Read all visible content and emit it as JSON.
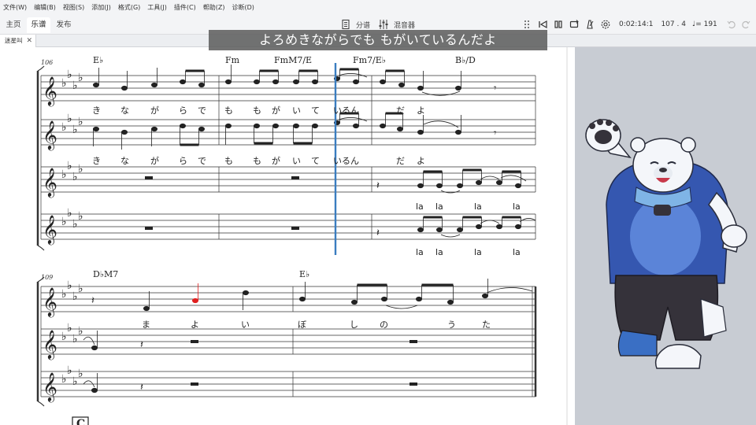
{
  "menu": [
    "文件(W)",
    "编辑(B)",
    "视图(S)",
    "添加(J)",
    "格式(G)",
    "工具(J)",
    "插件(C)",
    "帮助(Z)",
    "诊断(D)"
  ],
  "tabs": [
    {
      "label": "主页",
      "active": false
    },
    {
      "label": "乐谱",
      "active": true
    },
    {
      "label": "发布",
      "active": false
    }
  ],
  "toolbar": {
    "parts_label": "分谱",
    "mixer_label": "混音器",
    "time": "0:02:14:1",
    "position": "107 . 4",
    "tempo": "♩= 191"
  },
  "document_tab": {
    "title": "迷星叫",
    "close": "✕"
  },
  "lyric_overlay": "よろめきながらでも もがいているんだよ",
  "system1": {
    "measure_number": "106",
    "chords": [
      "E♭",
      "Fm",
      "FmM7/E",
      "Fm7/E♭",
      "B♭/D"
    ],
    "lyrics_top": [
      "き",
      "な",
      "が",
      "ら",
      "で",
      "も",
      "も",
      "が",
      "い",
      "て",
      "いるん",
      "だ",
      "よ"
    ],
    "lyrics_second": [
      "き",
      "な",
      "が",
      "ら",
      "で",
      "も",
      "も",
      "が",
      "い",
      "て",
      "いるん",
      "だ",
      "よ"
    ],
    "la_third": [
      "la",
      "la",
      "la",
      "la"
    ],
    "la_fourth": [
      "la",
      "la",
      "la",
      "la"
    ]
  },
  "system2": {
    "measure_number": "109",
    "chords": [
      "D♭M7",
      "E♭"
    ],
    "lyrics": [
      "ま",
      "よ",
      "い",
      "ぼ",
      "し",
      "の",
      "う",
      "た"
    ]
  },
  "rehearsal_mark": "C",
  "colors": {
    "cursor": "#3a7dc0",
    "selected_note": "#e02020",
    "side_panel": "#c8ccd3",
    "jacket": "#3557b0"
  }
}
